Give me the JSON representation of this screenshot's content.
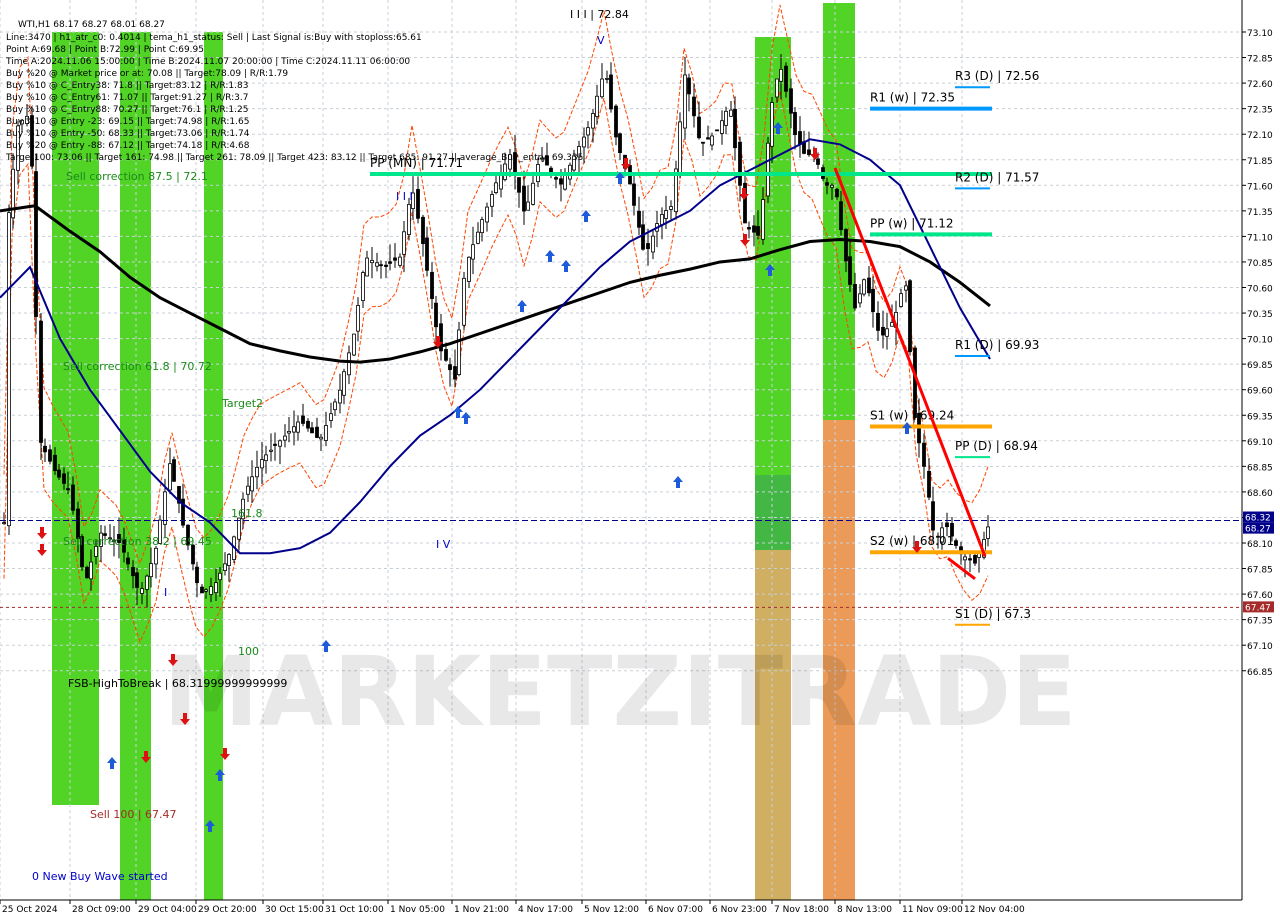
{
  "symbol_header": "WTI,H1  68.17 68.27 68.01 68.27",
  "info_lines": [
    "Line:3470 | h1_atr_c0: 0.4014 | tema_h1_status: Sell | Last Signal is:Buy with stoploss:65.61",
    "Point A:69.68 | Point B:72.99 | Point C:69.95",
    "Time A:2024.11.06 15:00:00 | Time B:2024.11.07 20:00:00 | Time C:2024.11.11 06:00:00",
    "Buy %20 @ Market price or at: 70.08 || Target:78.09 | R/R:1.79",
    "Buy %10 @ C_Entry38: 71.8 || Target:83.12 | R/R:1.83",
    "Buy %10 @ C_Entry61: 71.07 || Target:91.27 | R/R:3.7",
    "Buy %10 @ C_Entry88: 70.27 || Target:76.1 | R/R:1.25",
    "Buy %10 @ Entry -23: 69.15 || Target:74.98 | R/R:1.65",
    "Buy %10 @ Entry -50: 68.33 || Target:73.06 | R/R:1.74",
    "Buy %20 @ Entry -88: 67.12 || Target:74.18 | R/R:4.68",
    "Target100: 73.06 || Target 161: 74.98 || Target 261: 78.09 || Target 423: 83.12 || Target 685: 91.27 || average_Buy_entry: 69.335"
  ],
  "watermark": "MARKETZITRADE",
  "colors": {
    "background": "#ffffff",
    "grid": "#c8d0d8",
    "candle": "#000000",
    "ma_fast": "#00008b",
    "ma_slow": "#000000",
    "envelope": "#ff4500",
    "green_band": "#33cc00",
    "orange_band": "#e8883a",
    "pp_line": "#00e68a",
    "r_line": "#0099ff",
    "s_line": "#ffa500",
    "trend_line": "#ff0000",
    "price_tag_blue": "#00008b",
    "price_tag_red": "#a52a2a"
  },
  "chart_data": {
    "type": "candlestick",
    "y_axis_range": [
      66.85,
      73.2
    ],
    "y_ticks": [
      "73.10",
      "72.85",
      "72.60",
      "72.35",
      "72.10",
      "71.85",
      "71.60",
      "71.35",
      "71.10",
      "70.85",
      "70.60",
      "70.35",
      "70.10",
      "69.85",
      "69.60",
      "69.35",
      "69.10",
      "68.85",
      "68.60",
      "68.35",
      "68.10",
      "67.85",
      "67.60",
      "67.35",
      "67.10",
      "66.85"
    ],
    "x_ticks": [
      "25 Oct 2024",
      "28 Oct 09:00",
      "29 Oct 04:00",
      "29 Oct 20:00",
      "30 Oct 15:00",
      "31 Oct 10:00",
      "1 Nov 05:00",
      "1 Nov 21:00",
      "4 Nov 17:00",
      "5 Nov 12:00",
      "6 Nov 07:00",
      "6 Nov 23:00",
      "7 Nov 18:00",
      "8 Nov 13:00",
      "11 Nov 09:00",
      "12 Nov 04:00"
    ],
    "price_tags": [
      {
        "label": "68.32",
        "value": 68.32,
        "kind": "current"
      },
      {
        "label": "68.27",
        "value": 68.27,
        "kind": "last"
      },
      {
        "label": "67.47",
        "value": 67.47,
        "kind": "stop"
      }
    ],
    "levels": [
      {
        "label": "R3 (D) | 72.56",
        "value": 72.56,
        "kind": "R"
      },
      {
        "label": "R1 (w) | 72.35",
        "value": 72.35,
        "kind": "R"
      },
      {
        "label": "PP (MN) | 71.71",
        "value": 71.71,
        "kind": "PP"
      },
      {
        "label": "R2 (D) | 71.57",
        "value": 71.57,
        "kind": "R"
      },
      {
        "label": "PP (w) | 71.12",
        "value": 71.12,
        "kind": "PP"
      },
      {
        "label": "R1 (D) | 69.93",
        "value": 69.93,
        "kind": "R"
      },
      {
        "label": "S1 (w) | 69.24",
        "value": 69.24,
        "kind": "S"
      },
      {
        "label": "PP (D) | 68.94",
        "value": 68.94,
        "kind": "PP"
      },
      {
        "label": "S2 (w) | 68.01",
        "value": 68.01,
        "kind": "S"
      },
      {
        "label": "S1 (D) | 67.3",
        "value": 67.3,
        "kind": "S"
      }
    ],
    "annotations": [
      {
        "label": "I I I | 72.84"
      },
      {
        "label": "Sell correction 87.5 | 72.1"
      },
      {
        "label": "Sell correction 61.8 | 70.72"
      },
      {
        "label": "Sell correction 38.2 | 69.45"
      },
      {
        "label": "FSB-HighToBreak | 68.31999999999999"
      },
      {
        "label": "Sell 100 | 67.47"
      },
      {
        "label": "0 New Buy Wave started"
      },
      {
        "label": "Target2"
      },
      {
        "label": "161.8"
      },
      {
        "label": "100"
      },
      {
        "label": "I I I"
      },
      {
        "label": "I V"
      },
      {
        "label": "V"
      },
      {
        "label": "I"
      }
    ],
    "ma_fast": [
      [
        0,
        70.5
      ],
      [
        30,
        70.8
      ],
      [
        60,
        70.1
      ],
      [
        90,
        69.6
      ],
      [
        120,
        69.2
      ],
      [
        150,
        68.8
      ],
      [
        180,
        68.5
      ],
      [
        210,
        68.3
      ],
      [
        240,
        68.0
      ],
      [
        270,
        68.0
      ],
      [
        300,
        68.05
      ],
      [
        330,
        68.2
      ],
      [
        360,
        68.5
      ],
      [
        390,
        68.85
      ],
      [
        420,
        69.15
      ],
      [
        450,
        69.35
      ],
      [
        480,
        69.6
      ],
      [
        510,
        69.9
      ],
      [
        540,
        70.2
      ],
      [
        570,
        70.5
      ],
      [
        600,
        70.8
      ],
      [
        630,
        71.05
      ],
      [
        660,
        71.2
      ],
      [
        690,
        71.35
      ],
      [
        720,
        71.6
      ],
      [
        750,
        71.75
      ],
      [
        780,
        71.9
      ],
      [
        810,
        72.05
      ],
      [
        840,
        72.0
      ],
      [
        870,
        71.85
      ],
      [
        900,
        71.6
      ],
      [
        930,
        71.0
      ],
      [
        960,
        70.4
      ],
      [
        990,
        69.9
      ]
    ],
    "ma_slow": [
      [
        0,
        71.35
      ],
      [
        35,
        71.4
      ],
      [
        70,
        71.15
      ],
      [
        100,
        70.95
      ],
      [
        130,
        70.7
      ],
      [
        160,
        70.5
      ],
      [
        190,
        70.35
      ],
      [
        220,
        70.2
      ],
      [
        250,
        70.05
      ],
      [
        280,
        69.98
      ],
      [
        310,
        69.92
      ],
      [
        340,
        69.88
      ],
      [
        360,
        69.87
      ],
      [
        390,
        69.9
      ],
      [
        420,
        69.97
      ],
      [
        450,
        70.05
      ],
      [
        480,
        70.15
      ],
      [
        510,
        70.25
      ],
      [
        540,
        70.35
      ],
      [
        570,
        70.45
      ],
      [
        600,
        70.55
      ],
      [
        630,
        70.65
      ],
      [
        660,
        70.72
      ],
      [
        690,
        70.78
      ],
      [
        720,
        70.85
      ],
      [
        750,
        70.88
      ],
      [
        780,
        70.97
      ],
      [
        810,
        71.05
      ],
      [
        840,
        71.07
      ],
      [
        870,
        71.05
      ],
      [
        900,
        71.0
      ],
      [
        930,
        70.85
      ],
      [
        960,
        70.65
      ],
      [
        990,
        70.42
      ]
    ],
    "trend_lines": [
      [
        [
          835,
          71.77
        ],
        [
          985,
          67.97
        ]
      ],
      [
        [
          948,
          67.95
        ],
        [
          975,
          67.75
        ]
      ]
    ]
  }
}
